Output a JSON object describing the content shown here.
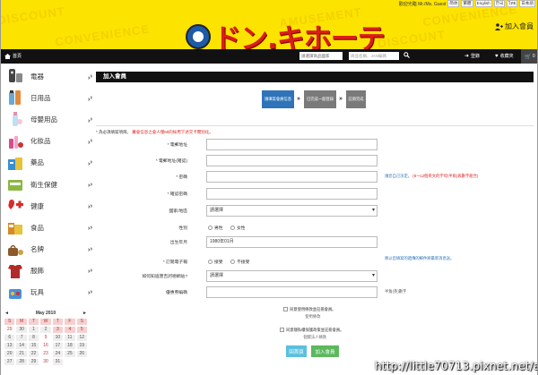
{
  "topbar": {
    "welcome": "歡迎光臨 Mr./Ms. Guest",
    "languages": [
      "简体",
      "繁體",
      "English",
      "한국",
      "ไทย",
      "日本語"
    ]
  },
  "banner": {
    "logo_text": "ドン.キホーテ",
    "watermark_words": [
      "DISCOUNT",
      "CONVENIENCE",
      "AMUSEMENT",
      "DISCOUNT",
      "CONVENIENCE"
    ],
    "join_label": "加入會員"
  },
  "navbar": {
    "home_label": "首頁",
    "search1_placeholder": "請選擇商品國家",
    "search2_placeholder": "商品名稱、JAN編碼",
    "login_label": "登錄",
    "fav_label": "收藏夾",
    "cart_count": "0"
  },
  "sidebar": {
    "categories": [
      {
        "label": "電器",
        "icon": "appliance-icon",
        "color": "#555"
      },
      {
        "label": "日用品",
        "icon": "daily-goods-icon",
        "color": "#6aa8d8"
      },
      {
        "label": "母嬰用品",
        "icon": "baby-icon",
        "color": "#e58fb0"
      },
      {
        "label": "化妝品",
        "icon": "cosmetics-icon",
        "color": "#d94d8a"
      },
      {
        "label": "藥品",
        "icon": "medicine-icon",
        "color": "#3a8fd1"
      },
      {
        "label": "衛生保健",
        "icon": "health-care-icon",
        "color": "#8ab842"
      },
      {
        "label": "健康",
        "icon": "health-cross-icon",
        "color": "#d92b2b"
      },
      {
        "label": "食品",
        "icon": "food-icon",
        "color": "#d48a2a"
      },
      {
        "label": "名牌",
        "icon": "brand-icon",
        "color": "#8a5a2b"
      },
      {
        "label": "服飾",
        "icon": "clothing-icon",
        "color": "#b22a2a"
      },
      {
        "label": "玩具",
        "icon": "toy-icon",
        "color": "#4a90d9"
      }
    ]
  },
  "calendar": {
    "prev": "◄",
    "next": "►",
    "month": "May 2010",
    "cells": [
      {
        "t": "S",
        "c": "dh"
      },
      {
        "t": "M",
        "c": "dh"
      },
      {
        "t": "T",
        "c": "dh"
      },
      {
        "t": "W",
        "c": "dh"
      },
      {
        "t": "T",
        "c": "dh"
      },
      {
        "t": "F",
        "c": "dh"
      },
      {
        "t": "S",
        "c": "dh"
      },
      {
        "t": "29",
        "c": "dr"
      },
      {
        "t": "30",
        "c": "dc"
      },
      {
        "t": "1",
        "c": "dc"
      },
      {
        "t": "2",
        "c": "dc"
      },
      {
        "t": "3",
        "c": "dh"
      },
      {
        "t": "4",
        "c": "dh"
      },
      {
        "t": "5",
        "c": "dh"
      },
      {
        "t": "6",
        "c": "dc"
      },
      {
        "t": "7",
        "c": "dc"
      },
      {
        "t": "8",
        "c": "dc"
      },
      {
        "t": "9",
        "c": "dr"
      },
      {
        "t": "10",
        "c": "dc"
      },
      {
        "t": "11",
        "c": "dc"
      },
      {
        "t": "12",
        "c": "dc"
      },
      {
        "t": "13",
        "c": "dc"
      },
      {
        "t": "14",
        "c": "dc"
      },
      {
        "t": "15",
        "c": "dc"
      },
      {
        "t": "16",
        "c": "dr"
      },
      {
        "t": "17",
        "c": "dc"
      },
      {
        "t": "18",
        "c": "dc"
      },
      {
        "t": "19",
        "c": "dc"
      },
      {
        "t": "20",
        "c": "dc"
      },
      {
        "t": "21",
        "c": "dc"
      },
      {
        "t": "22",
        "c": "dc"
      },
      {
        "t": "23",
        "c": "dr"
      },
      {
        "t": "24",
        "c": "dc"
      },
      {
        "t": "25",
        "c": "dc"
      },
      {
        "t": "26",
        "c": "dc"
      },
      {
        "t": "27",
        "c": "dc"
      },
      {
        "t": "28",
        "c": "dc"
      },
      {
        "t": "29",
        "c": "dc"
      },
      {
        "t": "30",
        "c": "dr"
      },
      {
        "t": "31",
        "c": "dc"
      },
      {
        "t": "",
        "c": "dn"
      },
      {
        "t": "",
        "c": "dn"
      }
    ]
  },
  "content": {
    "title": "加入會員",
    "steps": [
      "請填寫會員信息",
      "已完成一般登錄",
      "註冊完成"
    ],
    "note_prefix": "* 為必須填寫項目。",
    "note_red": "蕭會信息之會人僅Mt的採用下述交卡實別化。",
    "fields": {
      "email_label": "* 電郵地址",
      "email_confirm_label": "* 電郵地址(確認)",
      "password_label": "* 密碼",
      "password_hint": "請您自己決定。",
      "password_hint_red": "(8～12個英文的字母(半角)與數字組合)",
      "password_confirm_label": "* 確認密碼",
      "country_label": "國家/地區",
      "country_value": "請選擇",
      "gender_label": "性別",
      "gender_male": "男性",
      "gender_female": "女性",
      "birthday_label": "出生年月",
      "birthday_value": "1980年01月",
      "newsletter_label": "* 訂閱電子報",
      "newsletter_yes": "接受",
      "newsletter_no": "不接受",
      "newsletter_hint": "將以您填寫的遞傳的郵件將最新消息送。",
      "source_label": "如何知道唐吉訶德網站?",
      "source_value": "請選擇",
      "referrer_label": "優惠券編碼",
      "referrer_hint": "半角(英)數字",
      "terms1": "同意使用條款並註冊會員。",
      "terms1_link": "使用條款",
      "terms2": "同意隱私權保護政策並註冊會員。",
      "terms2_link": "個資法人條款"
    },
    "buttons": {
      "back": "回首頁",
      "join": "加入會員"
    }
  },
  "watermark": "http://little70713.pixnet.net/album"
}
